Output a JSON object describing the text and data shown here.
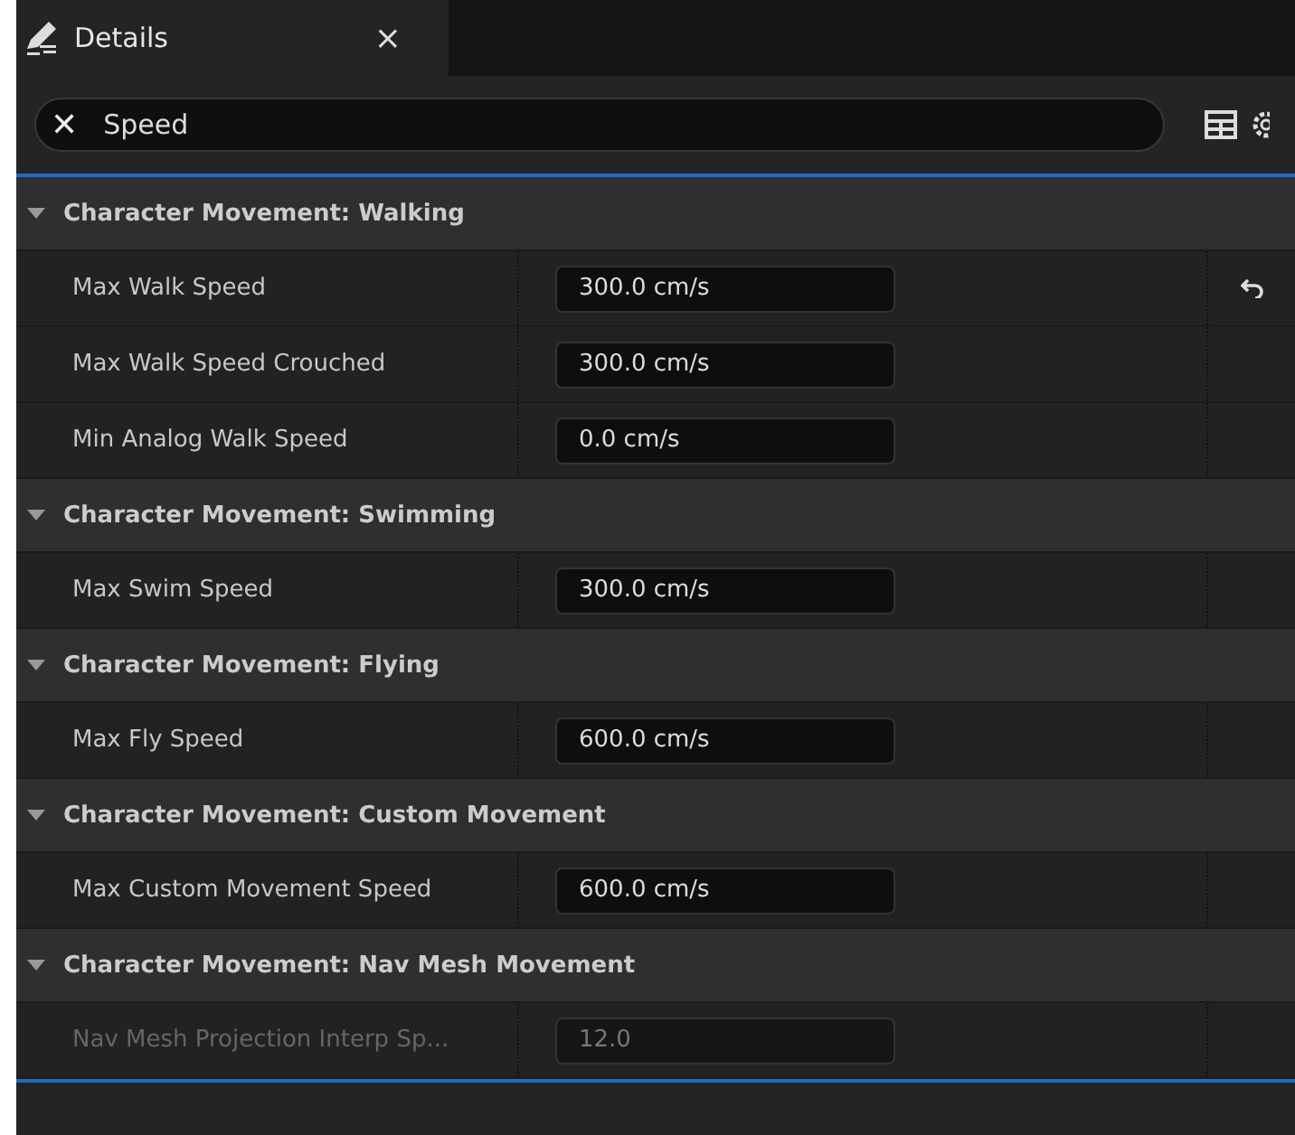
{
  "tab": {
    "title": "Details",
    "close": "×"
  },
  "search": {
    "clear": "✕",
    "value": "Speed"
  },
  "categories": [
    {
      "title": "Character Movement: Walking",
      "expanded": true,
      "properties": [
        {
          "name": "Max Walk Speed",
          "value": "300.0 cm/s",
          "modified": true,
          "disabled": false
        },
        {
          "name": "Max Walk Speed Crouched",
          "value": "300.0 cm/s",
          "modified": false,
          "disabled": false
        },
        {
          "name": "Min Analog Walk Speed",
          "value": "0.0 cm/s",
          "modified": false,
          "disabled": false
        }
      ]
    },
    {
      "title": "Character Movement: Swimming",
      "expanded": true,
      "properties": [
        {
          "name": "Max Swim Speed",
          "value": "300.0 cm/s",
          "modified": false,
          "disabled": false
        }
      ]
    },
    {
      "title": "Character Movement: Flying",
      "expanded": true,
      "properties": [
        {
          "name": "Max Fly Speed",
          "value": "600.0 cm/s",
          "modified": false,
          "disabled": false
        }
      ]
    },
    {
      "title": "Character Movement: Custom Movement",
      "expanded": true,
      "properties": [
        {
          "name": "Max Custom Movement Speed",
          "value": "600.0 cm/s",
          "modified": false,
          "disabled": false
        }
      ]
    },
    {
      "title": "Character Movement: Nav Mesh Movement",
      "expanded": true,
      "properties": [
        {
          "name": "Nav Mesh Projection Interp Sp...",
          "value": "12.0",
          "modified": false,
          "disabled": true
        }
      ]
    }
  ]
}
